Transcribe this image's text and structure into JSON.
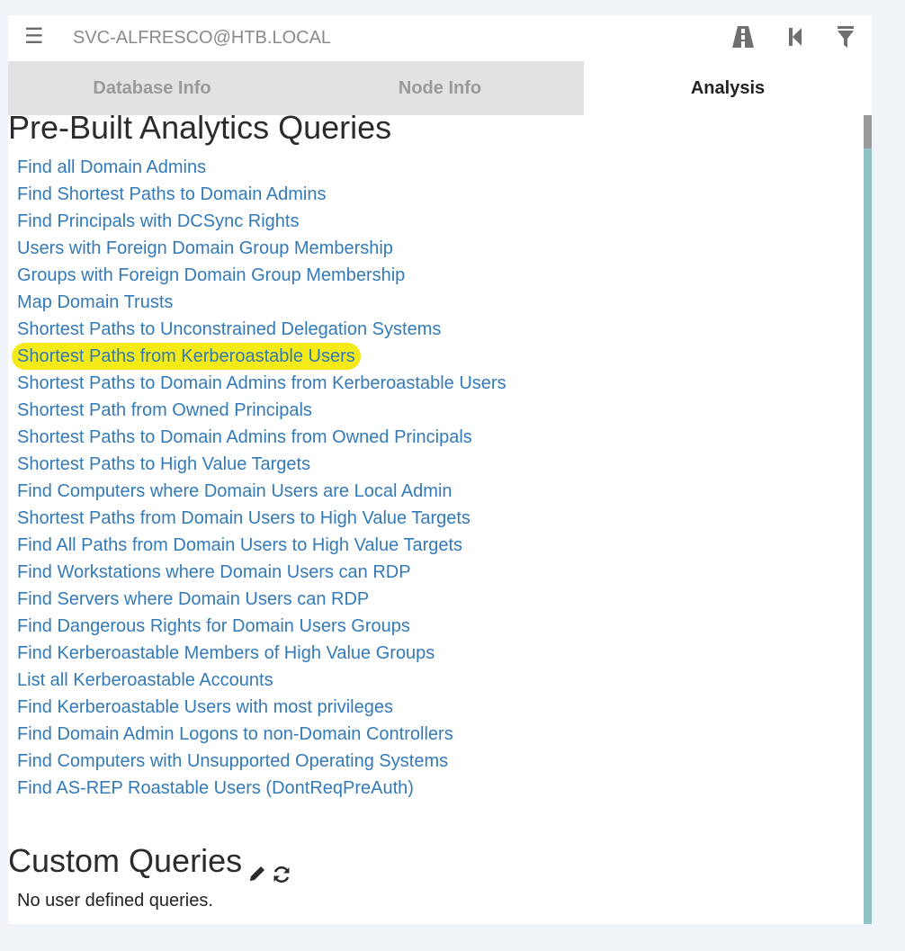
{
  "header": {
    "search_value": "SVC-ALFRESCO@HTB.LOCAL",
    "menu_icon": "hamburger-menu-icon",
    "tool_icons": [
      "pathfinding-road-icon",
      "back-step-icon",
      "filter-icon"
    ]
  },
  "tabs": [
    {
      "label": "Database Info",
      "active": false
    },
    {
      "label": "Node Info",
      "active": false
    },
    {
      "label": "Analysis",
      "active": true
    }
  ],
  "prebuilt": {
    "title": "Pre-Built Analytics Queries",
    "queries": [
      "Find all Domain Admins",
      "Find Shortest Paths to Domain Admins",
      "Find Principals with DCSync Rights",
      "Users with Foreign Domain Group Membership",
      "Groups with Foreign Domain Group Membership",
      "Map Domain Trusts",
      "Shortest Paths to Unconstrained Delegation Systems",
      "Shortest Paths from Kerberoastable Users",
      "Shortest Paths to Domain Admins from Kerberoastable Users",
      "Shortest Path from Owned Principals",
      "Shortest Paths to Domain Admins from Owned Principals",
      "Shortest Paths to High Value Targets",
      "Find Computers where Domain Users are Local Admin",
      "Shortest Paths from Domain Users to High Value Targets",
      "Find All Paths from Domain Users to High Value Targets",
      "Find Workstations where Domain Users can RDP",
      "Find Servers where Domain Users can RDP",
      "Find Dangerous Rights for Domain Users Groups",
      "Find Kerberoastable Members of High Value Groups",
      "List all Kerberoastable Accounts",
      "Find Kerberoastable Users with most privileges",
      "Find Domain Admin Logons to non-Domain Controllers",
      "Find Computers with Unsupported Operating Systems",
      "Find AS-REP Roastable Users (DontReqPreAuth)"
    ],
    "highlighted_index": 7
  },
  "custom": {
    "title": "Custom Queries",
    "empty_text": "No user defined queries.",
    "icons": [
      "pencil-edit-icon",
      "refresh-icon"
    ]
  },
  "colors": {
    "link": "#337ab7",
    "highlight": "#f4ea18",
    "scrollbar": "#90c3c6",
    "tab_inactive_bg": "#e2e2e2"
  }
}
